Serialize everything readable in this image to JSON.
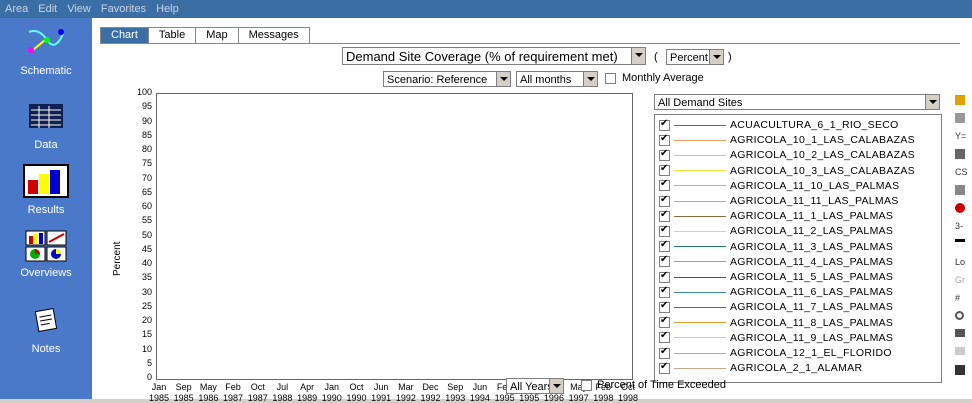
{
  "menu": [
    "Area",
    "Edit",
    "View",
    "Favorites",
    "Help"
  ],
  "nav": [
    {
      "label": "Schematic",
      "icon": "schematic-icon"
    },
    {
      "label": "Data",
      "icon": "data-icon"
    },
    {
      "label": "Results",
      "icon": "results-icon"
    },
    {
      "label": "Overviews",
      "icon": "overviews-icon"
    },
    {
      "label": "Notes",
      "icon": "notes-icon"
    }
  ],
  "tabs": [
    "Chart",
    "Table",
    "Map",
    "Messages"
  ],
  "variable": "Demand Site Coverage (% of requirement met)",
  "unit": "Percent",
  "unit_prefix": "(",
  "unit_suffix": ")",
  "scenario": "Scenario: Reference",
  "months": "All months",
  "monthly_avg": "Monthly Average",
  "site_filter": "All Demand Sites",
  "years": "All Years",
  "exceeded": "Percent of Time Exceeded",
  "colors": {
    "accent": "#3a6ea5",
    "sidebar": "#4a79c9"
  },
  "chart_data": {
    "type": "line",
    "ylabel": "Percent",
    "ylim": [
      0,
      100
    ],
    "yticks": [
      100,
      95,
      90,
      85,
      80,
      75,
      70,
      65,
      60,
      55,
      50,
      45,
      40,
      35,
      30,
      25,
      20,
      15,
      10,
      5,
      0
    ],
    "x_months": [
      "Jan",
      "Sep",
      "May",
      "Feb",
      "Oct",
      "Jul",
      "Apr",
      "Jan",
      "Oct",
      "Jun",
      "Mar",
      "Dec",
      "Sep",
      "Jun",
      "Feb",
      "Nov",
      "Aug",
      "May",
      "Feb",
      "Oct"
    ],
    "x_years": [
      "1985",
      "1985",
      "1986",
      "1987",
      "1987",
      "1988",
      "1989",
      "1990",
      "1990",
      "1991",
      "1992",
      "1992",
      "1993",
      "1994",
      "1995",
      "1995",
      "1996",
      "1997",
      "1998",
      "1998"
    ],
    "series": [
      {
        "name": "ACUACULTURA_6_1_RIO_SECO",
        "color": "#3d7a8c",
        "checked": true
      },
      {
        "name": "AGRICOLA_10_1_LAS_CALABAZAS",
        "color": "#e8a060",
        "checked": true
      },
      {
        "name": "AGRICOLA_10_2_LAS_CALABAZAS",
        "color": "#e8c840",
        "checked": true
      },
      {
        "name": "AGRICOLA_10_3_LAS_CALABAZAS",
        "color": "#f0e040",
        "checked": true
      },
      {
        "name": "AGRICOLA_11_10_LAS_PALMAS",
        "color": "#b0b0b0",
        "checked": true
      },
      {
        "name": "AGRICOLA_11_11_LAS_PALMAS",
        "color": "#c8a080",
        "checked": true
      },
      {
        "name": "AGRICOLA_11_1_LAS_PALMAS",
        "color": "#8a6a40",
        "checked": true
      },
      {
        "name": "AGRICOLA_11_2_LAS_PALMAS",
        "color": "#d0d0d0",
        "checked": true
      },
      {
        "name": "AGRICOLA_11_3_LAS_PALMAS",
        "color": "#2a7a6a",
        "checked": true
      },
      {
        "name": "AGRICOLA_11_4_LAS_PALMAS",
        "color": "#a0a0a0",
        "checked": true
      },
      {
        "name": "AGRICOLA_11_5_LAS_PALMAS",
        "color": "#305090",
        "checked": true
      },
      {
        "name": "AGRICOLA_11_6_LAS_PALMAS",
        "color": "#4090a0",
        "checked": true
      },
      {
        "name": "AGRICOLA_11_7_LAS_PALMAS",
        "color": "#c04030",
        "checked": true
      },
      {
        "name": "AGRICOLA_11_8_LAS_PALMAS",
        "color": "#e0a030",
        "checked": true
      },
      {
        "name": "AGRICOLA_11_9_LAS_PALMAS",
        "color": "#f0d030",
        "checked": true
      },
      {
        "name": "AGRICOLA_12_1_EL_FLORIDO",
        "color": "#a8a8a8",
        "checked": true
      },
      {
        "name": "AGRICOLA_2_1_ALAMAR",
        "color": "#c8a888",
        "checked": true
      }
    ]
  },
  "tools": [
    "Y=",
    "CS",
    "3-",
    "Lo",
    "Gr",
    "#"
  ]
}
